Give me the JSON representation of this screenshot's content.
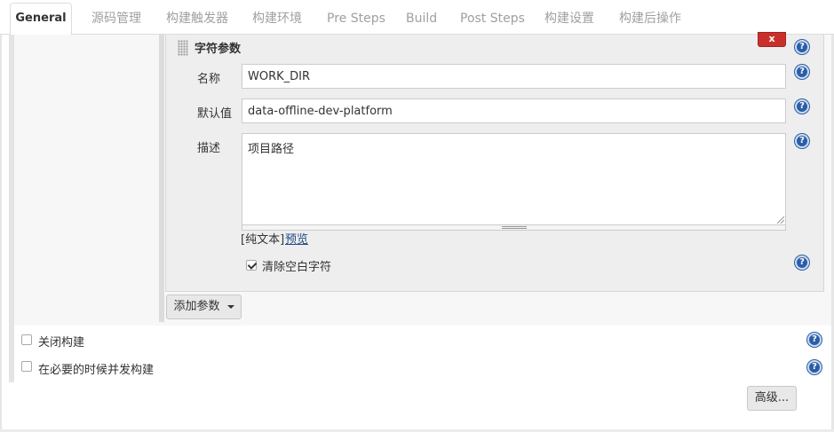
{
  "tabs": [
    {
      "label": "General",
      "active": true
    },
    {
      "label": "源码管理"
    },
    {
      "label": "构建触发器"
    },
    {
      "label": "构建环境"
    },
    {
      "label": "Pre Steps"
    },
    {
      "label": "Build"
    },
    {
      "label": "Post Steps"
    },
    {
      "label": "构建设置"
    },
    {
      "label": "构建后操作"
    }
  ],
  "param": {
    "title": "字符参数",
    "delete_label": "x",
    "name_label": "名称",
    "name_value": "WORK_DIR",
    "default_label": "默认值",
    "default_value": "data-offline-dev-platform",
    "description_label": "描述",
    "description_value": "项目路径",
    "text_mode": "[纯文本]",
    "preview_link": "预览",
    "trim_label": "清除空白字符",
    "trim_checked": true
  },
  "add_param_label": "添加参数",
  "options": {
    "disable_build": "关闭构建",
    "concurrent_build": "在必要的时候并发构建"
  },
  "advanced_label": "高级...",
  "help_glyph": "?",
  "icons": {
    "help": "help-icon",
    "dropdown": "caret-down-icon",
    "drag": "drag-handle-icon"
  },
  "colors": {
    "help_icon": "#2a5ea8",
    "delete_button": "#c9302c",
    "link": "#204a87"
  }
}
